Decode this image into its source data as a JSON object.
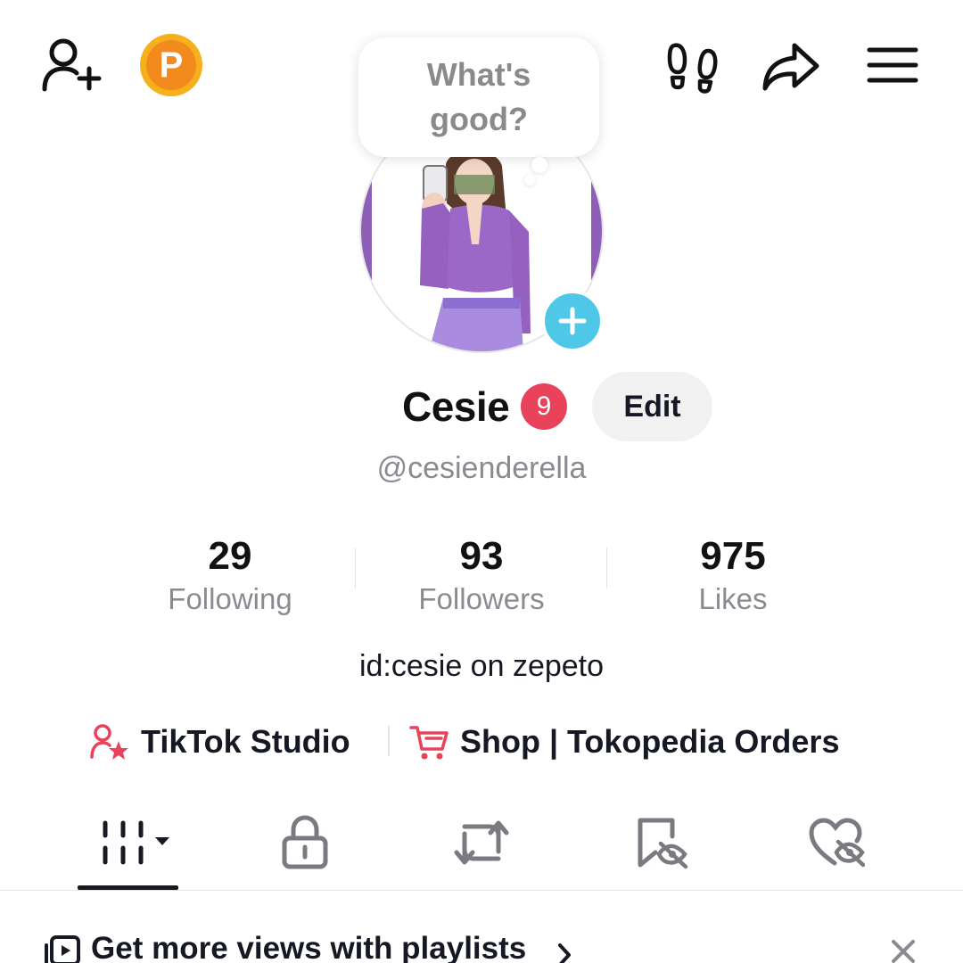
{
  "header": {
    "bubble_text": "What's good?",
    "coin_letter": "P"
  },
  "profile": {
    "display_name": "Cesie",
    "notification_count": "9",
    "edit_label": "Edit",
    "username": "@cesienderella",
    "bio": "id:cesie on zepeto"
  },
  "stats": [
    {
      "value": "29",
      "label": "Following"
    },
    {
      "value": "93",
      "label": "Followers"
    },
    {
      "value": "975",
      "label": "Likes"
    }
  ],
  "links": {
    "studio_label": "TikTok Studio",
    "shop_label": "Shop | Tokopedia Orders"
  },
  "tabs": [
    {
      "icon": "videos-grid-icon",
      "selected": true
    },
    {
      "icon": "lock-icon",
      "selected": false
    },
    {
      "icon": "repost-icon",
      "selected": false
    },
    {
      "icon": "hidden-favorites-icon",
      "selected": false
    },
    {
      "icon": "hidden-likes-icon",
      "selected": false
    }
  ],
  "banner": {
    "text": "Get more views with playlists"
  },
  "colors": {
    "accent_red": "#e8435a",
    "add_button_cyan": "#4fc8e8",
    "coin_orange": "#f28a1e",
    "avatar_purple": "#8e5fb8"
  }
}
